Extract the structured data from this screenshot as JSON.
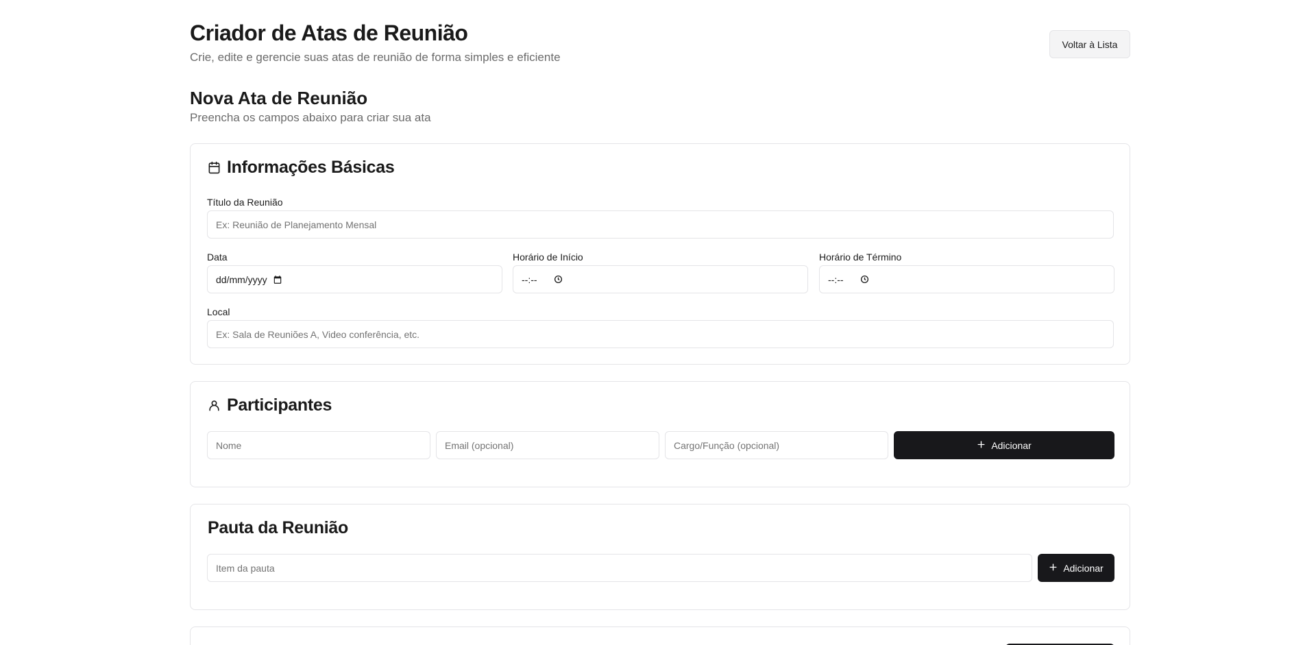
{
  "header": {
    "title": "Criador de Atas de Reunião",
    "subtitle": "Crie, edite e gerencie suas atas de reunião de forma simples e eficiente",
    "back_button": "Voltar à Lista"
  },
  "form": {
    "title": "Nova Ata de Reunião",
    "subtitle": "Preencha os campos abaixo para criar sua ata"
  },
  "basic_info": {
    "title": "Informações Básicas",
    "icon": "calendar-icon",
    "meeting_title_label": "Título da Reunião",
    "meeting_title_placeholder": "Ex: Reunião de Planejamento Mensal",
    "date_label": "Data",
    "date_value": "dd/mm/yyyy",
    "start_time_label": "Horário de Início",
    "start_time_value": "--:--",
    "end_time_label": "Horário de Término",
    "end_time_value": "--:--",
    "location_label": "Local",
    "location_placeholder": "Ex: Sala de Reuniões A, Video conferência, etc."
  },
  "participants": {
    "title": "Participantes",
    "icon": "user-icon",
    "name_placeholder": "Nome",
    "email_placeholder": "Email (opcional)",
    "role_placeholder": "Cargo/Função (opcional)",
    "add_button": "Adicionar"
  },
  "agenda": {
    "title": "Pauta da Reunião",
    "item_placeholder": "Item da pauta",
    "add_button": "Adicionar"
  }
}
